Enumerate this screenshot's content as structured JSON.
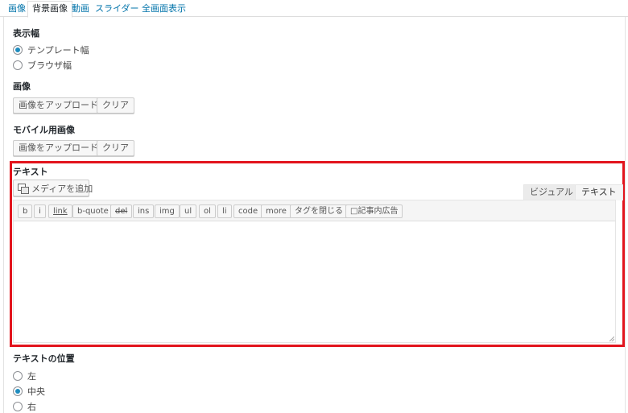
{
  "tabs": [
    "画像",
    "背景画像",
    "動画",
    "スライダー",
    "全画面表示"
  ],
  "display_width": {
    "heading": "表示幅",
    "options": [
      {
        "label": "テンプレート幅",
        "checked": true
      },
      {
        "label": "ブラウザ幅",
        "checked": false
      }
    ]
  },
  "image": {
    "heading": "画像",
    "upload_label": "画像をアップロード",
    "clear_label": "クリア"
  },
  "mobile_image": {
    "heading": "モバイル用画像",
    "upload_label": "画像をアップロード",
    "clear_label": "クリア"
  },
  "text_section": {
    "heading": "テキスト",
    "add_media_label": "メディアを追加",
    "visual_tab": "ビジュアル",
    "text_tab": "テキスト",
    "quicktags": [
      "b",
      "i",
      "link",
      "b-quote",
      "del",
      "ins",
      "img",
      "ul",
      "ol",
      "li",
      "code",
      "more",
      "タグを閉じる",
      "□記事内広告"
    ],
    "content": ""
  },
  "text_position": {
    "heading": "テキストの位置",
    "options": [
      {
        "label": "左",
        "checked": false
      },
      {
        "label": "中央",
        "checked": true
      },
      {
        "label": "右",
        "checked": false
      }
    ]
  },
  "colors": {
    "accent": "#0073aa",
    "highlight": "#e2141d"
  }
}
